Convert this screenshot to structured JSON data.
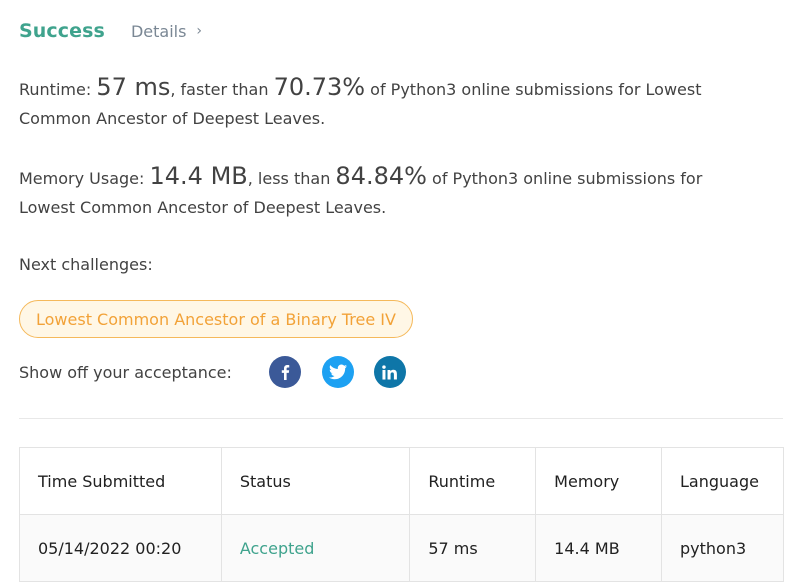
{
  "header": {
    "status": "Success",
    "details_label": "Details",
    "details_chevron": "›"
  },
  "runtime": {
    "label": "Runtime:",
    "value": "57 ms",
    "mid_text": ", faster than",
    "percent": "70.73%",
    "tail_text": "of Python3 online submissions for Lowest Common Ancestor of Deepest Leaves."
  },
  "memory": {
    "label": "Memory Usage:",
    "value": "14.4 MB",
    "mid_text": ", less than",
    "percent": "84.84%",
    "tail_text": "of Python3 online submissions for Lowest Common Ancestor of Deepest Leaves."
  },
  "next_challenges": {
    "label": "Next challenges:",
    "items": [
      "Lowest Common Ancestor of a Binary Tree IV"
    ]
  },
  "share": {
    "label": "Show off your acceptance:",
    "icons": [
      "facebook-icon",
      "twitter-icon",
      "linkedin-icon"
    ],
    "colors": {
      "facebook": "#3b5998",
      "twitter": "#1da1f2",
      "linkedin": "#0e76a8"
    }
  },
  "submissions": {
    "headers": [
      "Time Submitted",
      "Status",
      "Runtime",
      "Memory",
      "Language"
    ],
    "rows": [
      {
        "time": "05/14/2022 00:20",
        "status": "Accepted",
        "runtime": "57 ms",
        "memory": "14.4 MB",
        "language": "python3"
      }
    ]
  },
  "colors": {
    "success": "#3fa38d",
    "challenge_text": "#f2a238",
    "challenge_border": "#f5b95b",
    "challenge_bg": "#fff7e6"
  }
}
